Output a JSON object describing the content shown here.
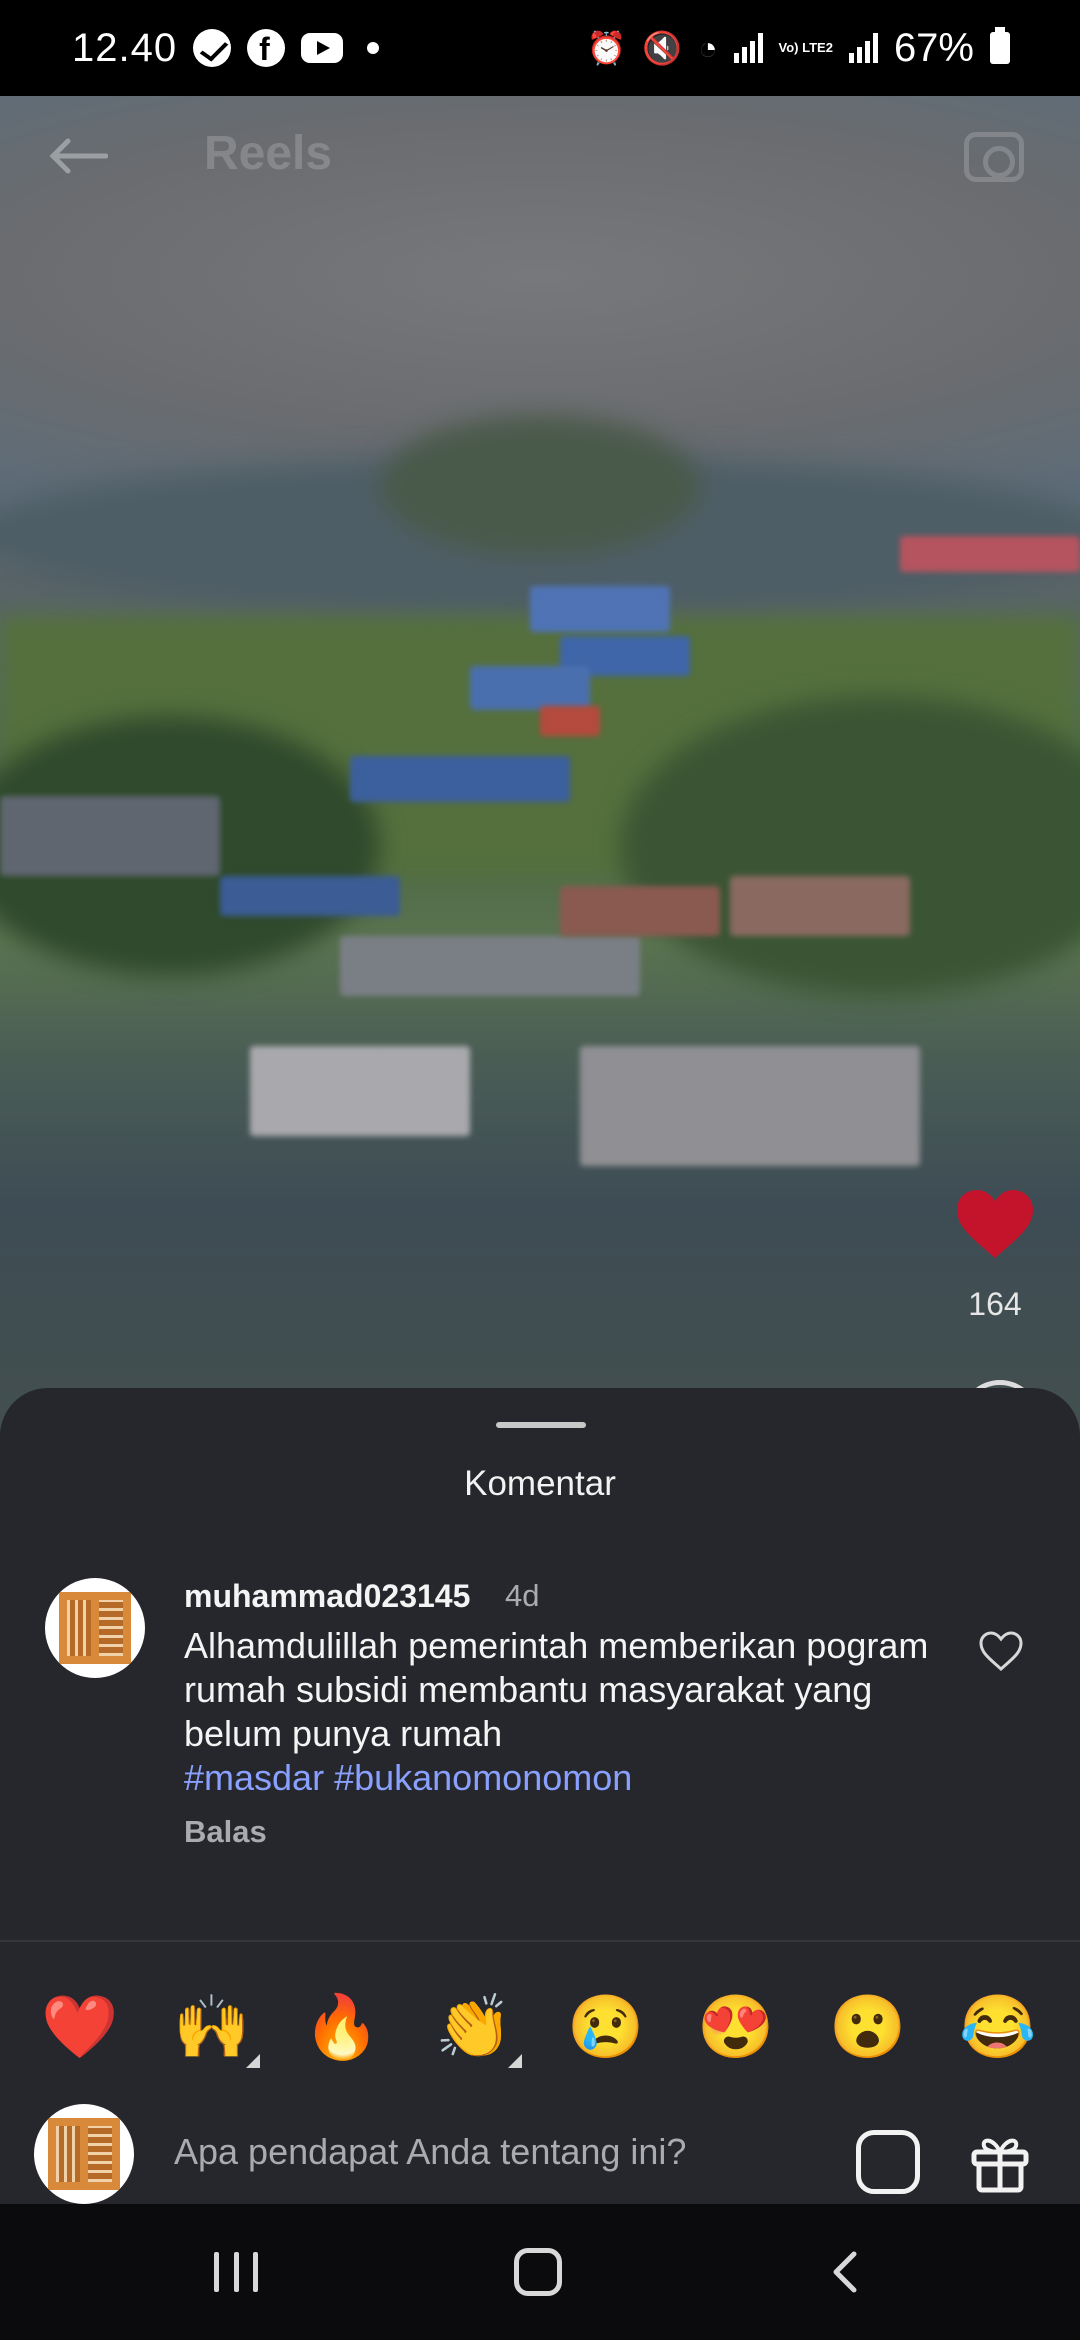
{
  "status_bar": {
    "time": "12.40",
    "apps": [
      "messenger-icon",
      "facebook-icon",
      "youtube-icon"
    ],
    "signal_label": "Vo) LTE2",
    "battery": "67%"
  },
  "reel": {
    "title": "Reels",
    "like_count": "164",
    "like_color": "#c4142b"
  },
  "comments_sheet": {
    "title": "Komentar",
    "comments": [
      {
        "username": "muhammad023145",
        "time": "4d",
        "text": "Alhamdulillah pemerintah memberikan pogram rumah subsidi membantu masyarakat yang belum punya rumah",
        "hashtags": "#masdar #bukanomonomon",
        "reply_label": "Balas"
      }
    ],
    "hashtag_color": "#8aa0ff",
    "quick_emojis": [
      "❤️",
      "🙌",
      "🔥",
      "👏",
      "😢",
      "😍",
      "😮",
      "😂"
    ],
    "input_placeholder": "Apa pendapat Anda tentang ini?"
  }
}
